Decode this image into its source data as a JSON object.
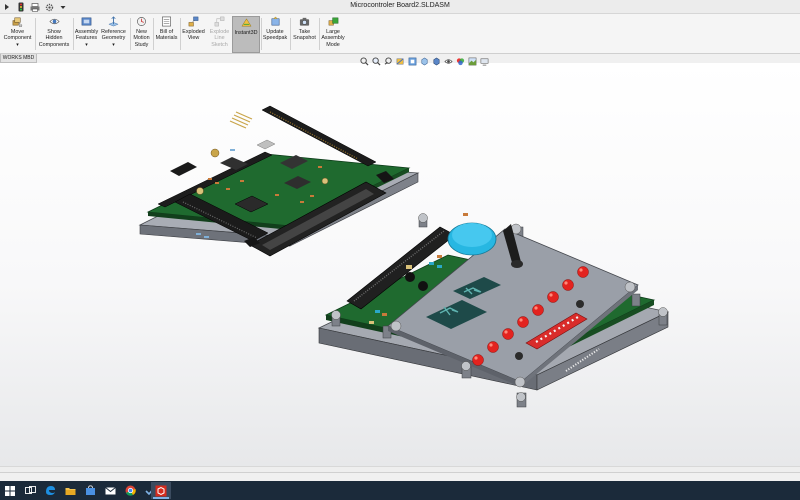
{
  "window": {
    "title": "Microcontroler Board2.SLDASM"
  },
  "colors": {
    "ribbon_bg": "#f5f5f5",
    "active_tool": "#bcbcbc",
    "taskbar": "#1b2a3a",
    "pcb_green": "#1f6a2f",
    "cover_grey": "#9a9fa8",
    "led_red": "#e3231f",
    "buzzer_blue": "#27b7e2"
  },
  "quick_access": [
    {
      "icon": "menu-caret-icon"
    },
    {
      "icon": "traffic-light-icon"
    },
    {
      "icon": "print-icon"
    },
    {
      "icon": "settings-icon"
    },
    {
      "icon": "dropdown-arrow-icon"
    }
  ],
  "ribbon": {
    "move_component": "Move\nComponent",
    "show_hidden": "Show\nHidden\nComponents",
    "assembly_features": "Assembly\nFeatures",
    "reference_geometry": "Reference\nGeometry",
    "new_motion_study": "New\nMotion\nStudy",
    "bill_of_materials": "Bill of\nMaterials",
    "exploded_view": "Exploded\nView",
    "explode_line_sketch": "Explode\nLine\nSketch",
    "instant3d": "Instant3D",
    "update_speedpak": "Update\nSpeedpak",
    "take_snapshot": "Take\nSnapshot",
    "large_assembly_mode": "Large\nAssembly\nMode"
  },
  "tabs": {
    "mbd": "WORKS MBD"
  },
  "view_toolbar": [
    {
      "icon": "zoom-to-fit-icon"
    },
    {
      "icon": "zoom-to-area-icon"
    },
    {
      "icon": "previous-view-icon"
    },
    {
      "icon": "section-view-icon"
    },
    {
      "icon": "dynamic-annotation-icon"
    },
    {
      "icon": "view-orientation-icon"
    },
    {
      "icon": "display-style-icon"
    },
    {
      "icon": "hide-show-items-icon"
    },
    {
      "icon": "edit-appearance-icon"
    },
    {
      "icon": "apply-scene-icon"
    },
    {
      "icon": "view-settings-icon"
    }
  ],
  "model": {
    "leds_count": 8,
    "dip_switch_positions": 8
  },
  "taskbar": [
    {
      "icon": "windows-start-icon"
    },
    {
      "icon": "task-view-icon"
    },
    {
      "icon": "edge-browser-icon"
    },
    {
      "icon": "file-explorer-icon"
    },
    {
      "icon": "store-icon"
    },
    {
      "icon": "mail-icon"
    },
    {
      "icon": "chrome-icon"
    },
    {
      "icon": "checkmark-app-icon"
    },
    {
      "icon": "solidworks-icon"
    }
  ]
}
